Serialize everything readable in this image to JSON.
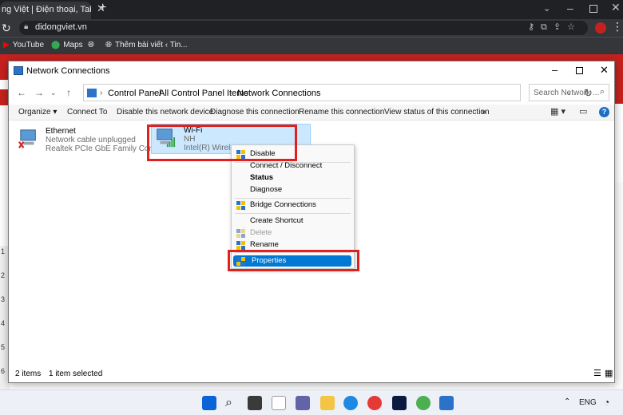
{
  "browser": {
    "tab_title": "ng Việt | Điện thoại, Tablet,",
    "tab_close": "✕",
    "new_tab": "+",
    "url": "didongviet.vn",
    "bookmarks": [
      "YouTube",
      "Maps",
      "Thêm bài viết ‹ Tin..."
    ]
  },
  "window": {
    "title": "Network Connections",
    "breadcrumbs": [
      "Control Panel",
      "All Control Panel Items",
      "Network Connections"
    ],
    "search_placeholder": "Search Network ...",
    "commands": [
      "Organize",
      "Connect To",
      "Disable this network device",
      "Diagnose this connection",
      "Rename this connection",
      "View status of this connection",
      "»"
    ]
  },
  "connections": [
    {
      "name": "Ethernet",
      "status": "Network cable unplugged",
      "device": "Realtek PCIe GbE Family Controller"
    },
    {
      "name": "Wi-Fi",
      "status": "NH",
      "device": "Intel(R) Wireless-"
    }
  ],
  "context_menu": {
    "items": [
      "Disable",
      "Connect / Disconnect",
      "Status",
      "Diagnose",
      "Bridge Connections",
      "Create Shortcut",
      "Delete",
      "Rename",
      "Properties"
    ]
  },
  "statusbar": {
    "items_count": "2 items",
    "selected": "1 item selected"
  },
  "site": {
    "left_numbers": [
      "1",
      "2",
      "3",
      "4",
      "5",
      "6"
    ]
  },
  "taskbar": {
    "language": "ENG"
  }
}
